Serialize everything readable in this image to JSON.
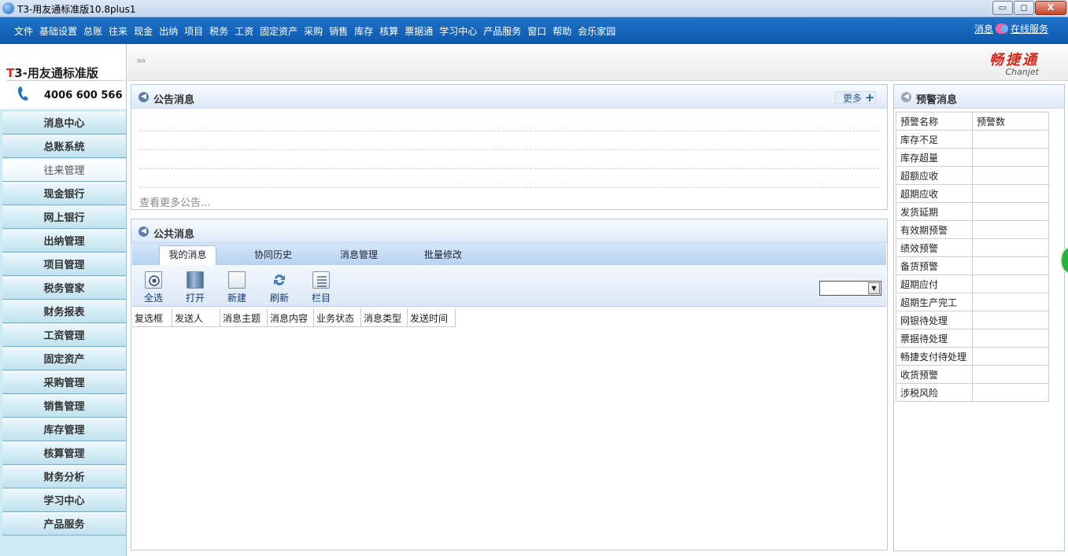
{
  "window": {
    "title": "T3-用友通标准版10.8plus1",
    "min_glyph": "▭",
    "max_glyph": "◻",
    "close_glyph": "X"
  },
  "menu": {
    "items": [
      "文件",
      "基础设置",
      "总账",
      "往来",
      "现金",
      "出纳",
      "项目",
      "税务",
      "工资",
      "固定资产",
      "采购",
      "销售",
      "库存",
      "核算",
      "票据通",
      "学习中心",
      "产品服务",
      "窗口",
      "帮助",
      "会乐家园"
    ],
    "message_link": "消息",
    "online_service": "在线服务"
  },
  "brand": {
    "product_prefix": "T",
    "product_rest": "3-用友通标准版",
    "phone": "4006 600 566",
    "top_arrows": "»»",
    "chanjet_cn": "畅捷通",
    "chanjet_en": "Chanjet"
  },
  "sidebar": {
    "items": [
      {
        "label": "消息中心"
      },
      {
        "label": "总账系统"
      },
      {
        "label": "往来管理",
        "active": true
      },
      {
        "label": "现金银行"
      },
      {
        "label": "网上银行"
      },
      {
        "label": "出纳管理"
      },
      {
        "label": "项目管理"
      },
      {
        "label": "税务管家"
      },
      {
        "label": "财务报表"
      },
      {
        "label": "工资管理"
      },
      {
        "label": "固定资产"
      },
      {
        "label": "采购管理"
      },
      {
        "label": "销售管理"
      },
      {
        "label": "库存管理"
      },
      {
        "label": "核算管理"
      },
      {
        "label": "财务分析"
      },
      {
        "label": "学习中心"
      },
      {
        "label": "产品服务"
      }
    ]
  },
  "announcement": {
    "title": "公告消息",
    "more": "更多",
    "more_plus": "+",
    "view_more": "查看更多公告..."
  },
  "public_messages": {
    "title": "公共消息",
    "tabs": [
      "我的消息",
      "协同历史",
      "消息管理",
      "批量修改"
    ],
    "toolbar": [
      "全选",
      "打开",
      "新建",
      "刷新",
      "栏目"
    ],
    "filter_value": "",
    "columns": [
      "复选框",
      "发送人",
      "消息主题",
      "消息内容",
      "业务状态",
      "消息类型",
      "发送时间"
    ]
  },
  "warnings": {
    "title": "预警消息",
    "header": [
      "预警名称",
      "预警数"
    ],
    "rows": [
      "库存不足",
      "库存超量",
      "超额应收",
      "超期应收",
      "发货延期",
      "有效期预警",
      "绩效预警",
      "备货预警",
      "超期应付",
      "超期生产完工",
      "网银待处理",
      "票据待处理",
      "畅捷支付待处理",
      "收货预警",
      "涉税风险"
    ]
  },
  "colors": {
    "menubar": "#0c58ad",
    "brand_red": "#d8261a",
    "sidebar_bg": "#cdeaf5"
  }
}
